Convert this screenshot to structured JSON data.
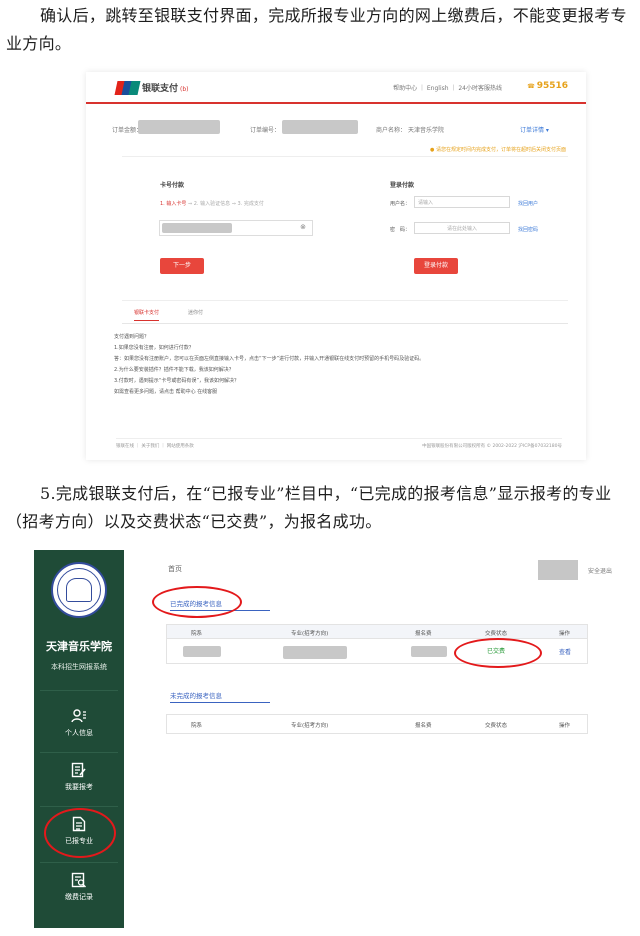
{
  "paragraph1": "确认后，跳转至银联支付界面，完成所报专业方向的网上缴费后，不能变更报考专业方向。",
  "paragraph2": "5.完成银联支付后，在“已报专业”栏目中，“已完成的报考信息”显示报考的专业（招考方向）以及交费状态“已交费”，为报名成功。",
  "unionpay": {
    "title": "银联支付",
    "title_tag": "(b)",
    "top_links": "帮助中心 ｜ English ｜ 24小时客服热线",
    "hotline": "95516",
    "order_amount_label": "订单金额：",
    "order_no_label": "订单编号：",
    "merchant_label": "商户名称：",
    "merchant_name": "天津音乐学院",
    "order_detail": "订单详情 ▾",
    "warning": "● 请您在规定时间内完成支付，订单将在超时后关闭支付页面",
    "card_pay_title": "卡号付款",
    "steps": [
      {
        "label": "1. 输入卡号",
        "active": true
      },
      {
        "label": "2. 输入验证信息",
        "active": false
      },
      {
        "label": "3. 完成支付",
        "active": false
      }
    ],
    "clear_icon": "⊗",
    "next_button": "下一步",
    "login_pay_title": "登录付款",
    "user_label": "用户名：",
    "user_placeholder": "请输入",
    "forgot_user": "找回用户",
    "password_label": "密　码：",
    "password_placeholder": "请在此处输入",
    "forgot_password": "找回密码",
    "login_button": "登录付款",
    "tabs": [
      "银联卡支付",
      "迷你付"
    ],
    "help_title": "支付遇到问题？",
    "help_lines": [
      "1.如果您没有注册，如何进行付款？",
      "答：如果您没有注册账户，您可以在页面左侧直接输入卡号，点击“下一步”进行付款，并输入开通银联在线支付时预留的手机号码及验证码。",
      "2.为什么要安装插件？插件不能下载，我该如何解决？",
      "3.付款时，遇到提示“卡号或密码有误”，我该如何解决？",
      "如需查看更多问题，请点击 帮助中心 在线客服"
    ],
    "footer_left": "银联在线 ｜ 关于我们 ｜ 网站使用条款",
    "footer_right": "中国银联股份有限公司版权所有 © 2002-2022 沪ICP备07032180号"
  },
  "portal": {
    "school_name": "天津音乐学院",
    "system_name": "本科招生网报系统",
    "nav": [
      {
        "label": "个人信息",
        "icon": "person-icon"
      },
      {
        "label": "我要报考",
        "icon": "edit-form-icon"
      },
      {
        "label": "已报专业",
        "icon": "document-icon",
        "highlighted": true
      },
      {
        "label": "缴费记录",
        "icon": "receipt-search-icon"
      }
    ],
    "breadcrumb": "首页",
    "logout": "安全退出",
    "completed_title": "已完成的报考信息",
    "incomplete_title": "未完成的报考信息",
    "columns": [
      "院系",
      "专业(招考方向)",
      "报名费",
      "交费状态",
      "操作"
    ],
    "completed_row": {
      "status": "已交费",
      "action": "查看"
    },
    "colors": {
      "sidebar": "#1f4b37",
      "accent_red": "#e3191b",
      "link_blue": "#3a63c0",
      "paid_green": "#2c9c3c"
    }
  }
}
